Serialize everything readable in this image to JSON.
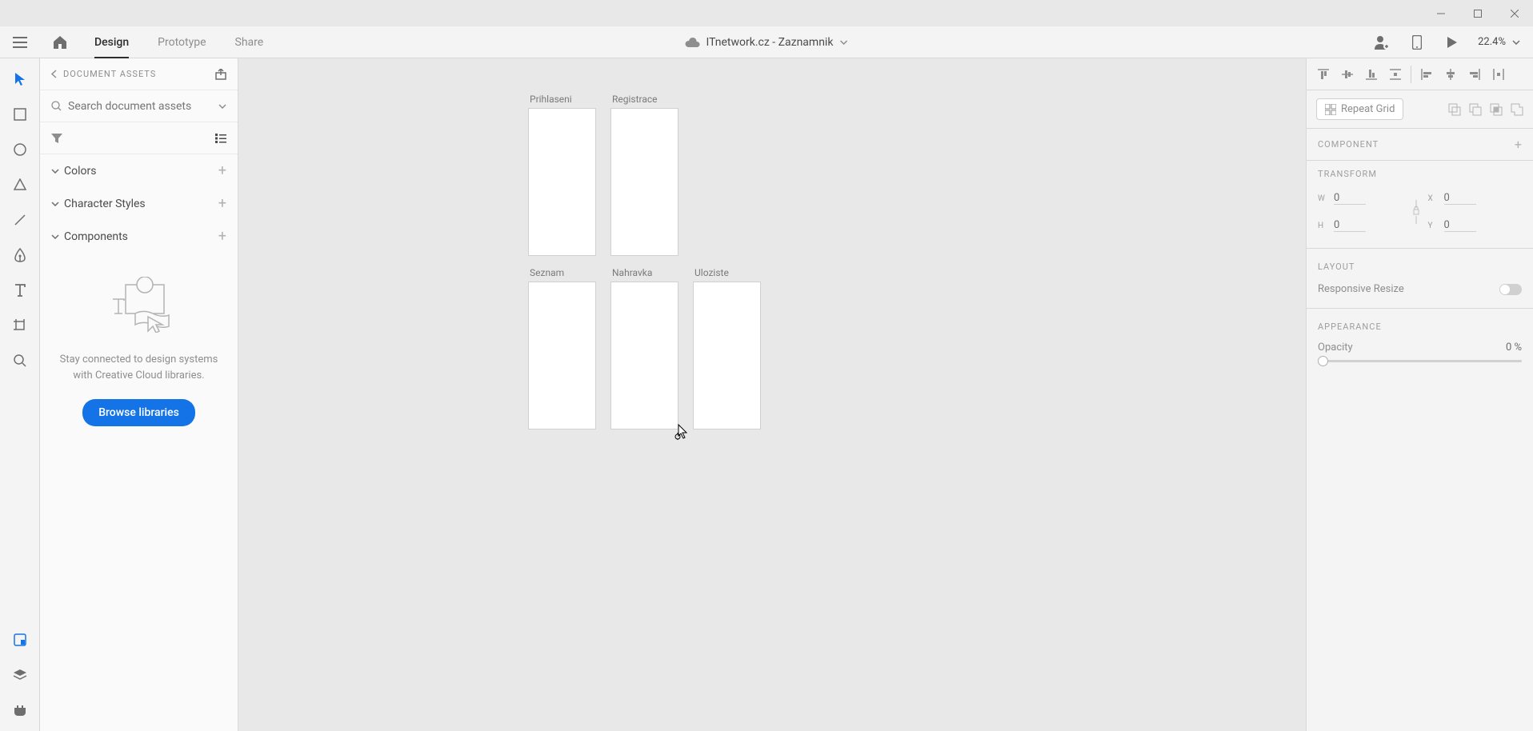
{
  "titlebar": {},
  "topbar": {
    "tabs": {
      "design": "Design",
      "prototype": "Prototype",
      "share": "Share"
    },
    "document_title": "ITnetwork.cz - Zaznamnik",
    "zoom": "22.4%"
  },
  "assets_panel": {
    "title": "DOCUMENT ASSETS",
    "search_placeholder": "Search document assets",
    "sections": {
      "colors": "Colors",
      "character_styles": "Character Styles",
      "components": "Components"
    },
    "empty_text": "Stay connected to design systems with Creative Cloud libraries.",
    "browse_button": "Browse libraries"
  },
  "artboards": [
    {
      "label": "Prihlaseni"
    },
    {
      "label": "Registrace"
    },
    {
      "label": "Seznam"
    },
    {
      "label": "Nahravka"
    },
    {
      "label": "Uloziste"
    }
  ],
  "right_panel": {
    "repeat_grid_label": "Repeat Grid",
    "component_label": "COMPONENT",
    "transform_label": "TRANSFORM",
    "transform": {
      "w": "0",
      "h": "0",
      "x": "0",
      "y": "0"
    },
    "layout_label": "LAYOUT",
    "responsive_resize_label": "Responsive Resize",
    "appearance_label": "APPEARANCE",
    "opacity_label": "Opacity",
    "opacity_value": "0 %"
  }
}
